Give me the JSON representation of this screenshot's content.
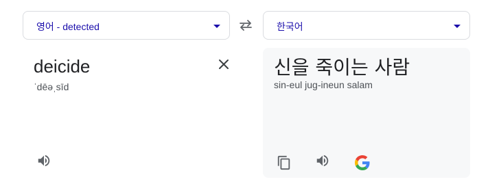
{
  "source": {
    "language_label": "영어 - detected",
    "text": "deicide",
    "phonetic": "ˈdēəˌsīd"
  },
  "target": {
    "language_label": "한국어",
    "text": "신을 죽이는 사람",
    "romanization": "sin-eul jug-ineun salam"
  },
  "icons": {
    "swap": "swap-arrows-icon",
    "clear": "close-icon",
    "source_speak": "speaker-icon",
    "copy": "copy-icon",
    "target_speak": "speaker-icon",
    "google": "google-g-icon"
  },
  "colors": {
    "language_link": "#1a0dab",
    "result_background": "#f7f8f9",
    "icon": "#5f6368"
  }
}
